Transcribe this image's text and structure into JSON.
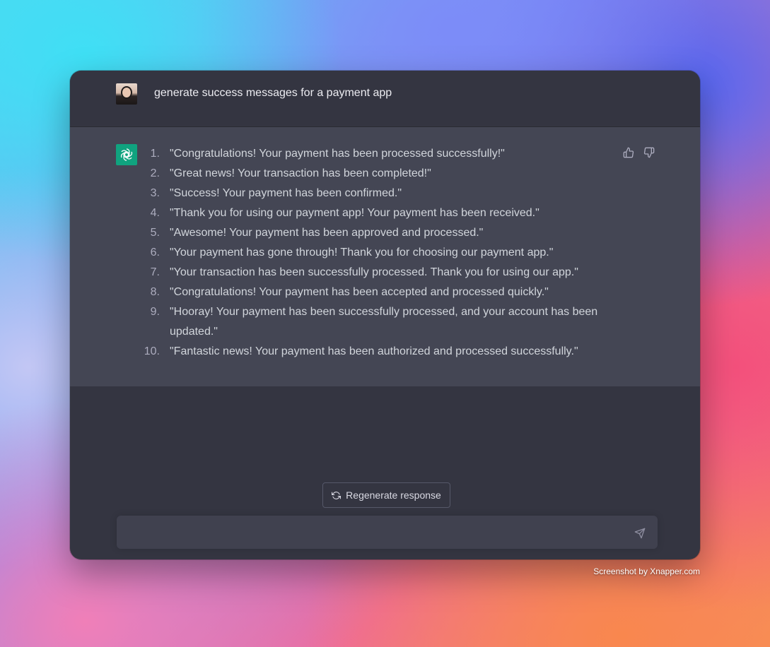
{
  "conversation": {
    "user_message": "generate success messages for a payment app",
    "assistant_items": [
      {
        "num": "1.",
        "text": "\"Congratulations! Your payment has been processed successfully!\""
      },
      {
        "num": "2.",
        "text": "\"Great news! Your transaction has been completed!\""
      },
      {
        "num": "3.",
        "text": "\"Success! Your payment has been confirmed.\""
      },
      {
        "num": "4.",
        "text": "\"Thank you for using our payment app! Your payment has been received.\""
      },
      {
        "num": "5.",
        "text": "\"Awesome! Your payment has been approved and processed.\""
      },
      {
        "num": "6.",
        "text": "\"Your payment has gone through! Thank you for choosing our payment app.\""
      },
      {
        "num": "7.",
        "text": "\"Your transaction has been successfully processed. Thank you for using our app.\""
      },
      {
        "num": "8.",
        "text": "\"Congratulations! Your payment has been accepted and processed quickly.\""
      },
      {
        "num": "9.",
        "text": "\"Hooray! Your payment has been successfully processed, and your account has been updated.\""
      },
      {
        "num": "10.",
        "text": "\"Fantastic news! Your payment has been authorized and processed successfully.\""
      }
    ]
  },
  "actions": {
    "regenerate_label": "Regenerate response"
  },
  "composer": {
    "value": "",
    "placeholder": ""
  },
  "icons": {
    "user_avatar": "user-avatar",
    "assistant_avatar": "openai-logo-icon",
    "thumbs_up": "thumbs-up-icon",
    "thumbs_down": "thumbs-down-icon",
    "regenerate": "refresh-icon",
    "send": "send-icon"
  },
  "colors": {
    "window_bg": "#343541",
    "assistant_bg": "#444654",
    "assistant_avatar_bg": "#10a37f",
    "composer_bg": "#40414f"
  },
  "watermark": "Screenshot by Xnapper.com"
}
